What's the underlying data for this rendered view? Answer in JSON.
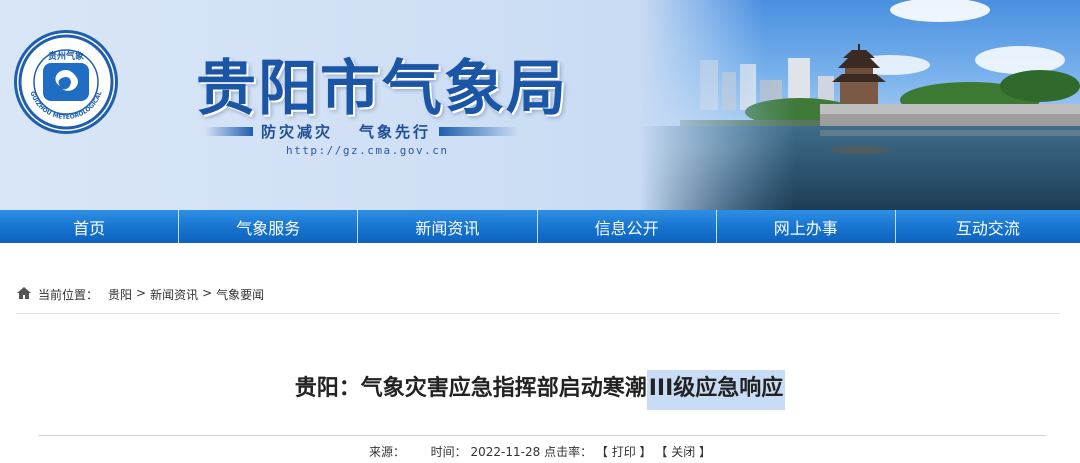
{
  "header": {
    "logo": {
      "text_top": "贵州气象",
      "text_arc": "GUIZHOU METEOROLOGICAL"
    },
    "title": "贵阳市气象局",
    "slogan_left": "防灾减灾",
    "slogan_right": "气象先行",
    "url": "http://gz.cma.gov.cn"
  },
  "nav": {
    "items": [
      {
        "label": "首页"
      },
      {
        "label": "气象服务"
      },
      {
        "label": "新闻资讯"
      },
      {
        "label": "信息公开"
      },
      {
        "label": "网上办事"
      },
      {
        "label": "互动交流"
      }
    ]
  },
  "breadcrumb": {
    "prefix": "当前位置：",
    "items": [
      "贵阳",
      "新闻资讯",
      "气象要闻"
    ],
    "separator": ">"
  },
  "article": {
    "title_main": "贵阳：气象灾害应急指挥部启动寒潮",
    "title_highlight": "III级应急响应",
    "source_label": "来源：",
    "time_label": "时间：",
    "date": "2022-11-28",
    "clicks_label": "点击率：",
    "print_label": "【 打印 】",
    "close_label": "【 关闭 】"
  },
  "colors": {
    "brand_blue": "#1a55a6",
    "nav_blue": "#1673cf",
    "highlight": "#c9dcf6"
  }
}
